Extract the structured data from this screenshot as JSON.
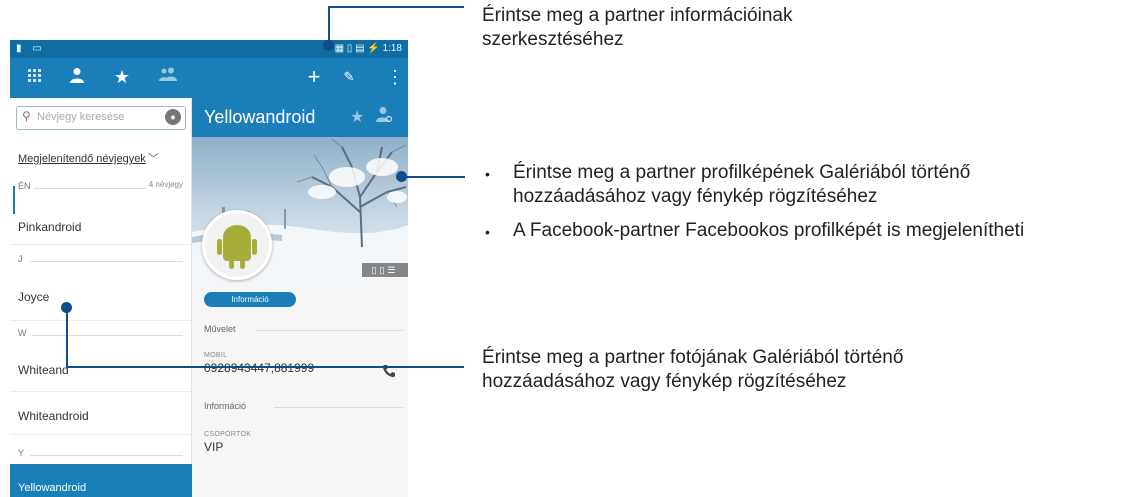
{
  "statusbar": {
    "left_icons": "▮ ▭",
    "right_text": "✈ ▦ ▯ ▤ ⚡ 1:18"
  },
  "toolbar": {
    "icons": [
      "grid-icon",
      "person-icon",
      "star-icon",
      "group-icon",
      "add-icon",
      "edit-icon",
      "more-icon"
    ]
  },
  "search": {
    "placeholder": "Névjegy keresése",
    "value": ""
  },
  "filter": {
    "label": "Megjelenítendő névjegyek"
  },
  "sections": {
    "en": {
      "letter": "ÉN",
      "count": "4 névjegy"
    },
    "j": {
      "letter": "J"
    },
    "w": {
      "letter": "W"
    },
    "y": {
      "letter": "Y"
    }
  },
  "contacts": [
    "Pinkandroid",
    "Joyce",
    "Whiteand",
    "Whiteandroid",
    "Yellowandroid"
  ],
  "detail": {
    "name": "Yellowandroid",
    "tab": "Információ",
    "section_action": "Művelet",
    "mobile_label": "MOBIL",
    "mobile_value": "0928943447,881999",
    "section_info": "Információ",
    "groups_label": "CSOPORTOK",
    "groups_value": "VIP"
  },
  "annotations": {
    "top": "Érintse meg a partner információinak szerkesztéséhez",
    "middle_bullet_1": "Érintse meg a partner profilképének Galériából történő hozzáadásához vagy fénykép rögzítéséhez",
    "middle_bullet_2": "A Facebook-partner Facebookos profilképét is megjelenítheti",
    "bottom": "Érintse meg a partner fotójának Galériából történő hozzáadásához vagy fénykép rögzítéséhez"
  },
  "colors": {
    "accent": "#1a7fb8",
    "statusbar": "#0f6da3",
    "callout": "#0f4e8a"
  }
}
